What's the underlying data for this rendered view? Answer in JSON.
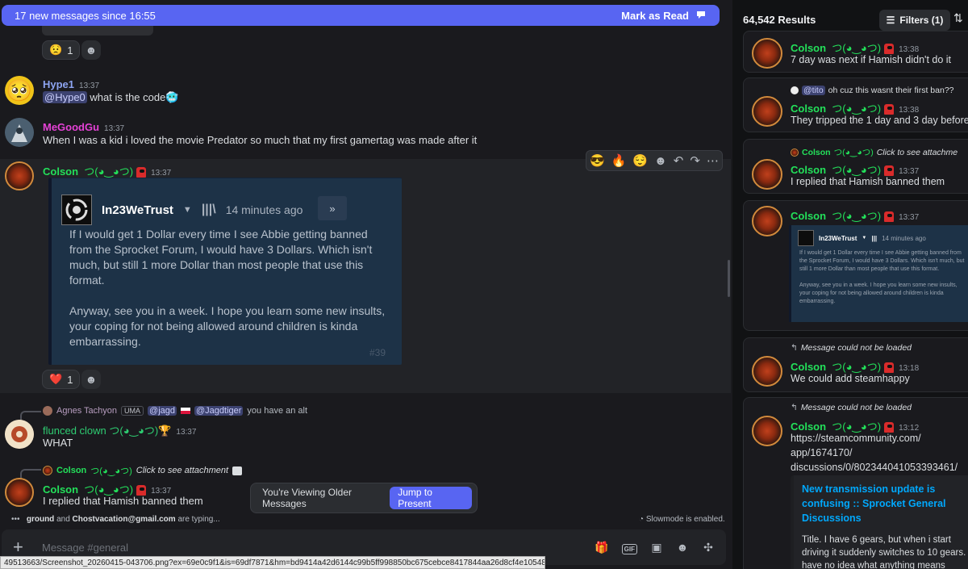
{
  "banner": {
    "text": "17 new messages since 16:55",
    "action": "Mark as Read"
  },
  "colors": {
    "accent": "#5865f2",
    "colson_green": "#23e05a",
    "hype_blue": "#8da4f1",
    "megoodgu_pink": "#e542d6",
    "link": "#00a8fc"
  },
  "top_reactions": {
    "emoji": "😟",
    "count": "1"
  },
  "messages": [
    {
      "author": "Hype1",
      "time": "13:37",
      "mention": "@Hype0",
      "text": " what is the code",
      "emoji": "🥶"
    },
    {
      "author": "MeGoodGu",
      "time": "13:37",
      "text": "When I was a kid i loved the movie Predator so much that my first gamertag was made after it"
    },
    {
      "author": "Colson",
      "suffix": "つ(◕‿◕つ)",
      "time": "13:37"
    },
    {
      "reply_author": "Agnes Tachyon",
      "reply_badge": "UMA",
      "reply_mention1": "@jagd",
      "reply_mention2": "@Jagdtiger",
      "reply_text": "you have an alt",
      "author": "flunced clown",
      "suffix": "つ(◕‿◕つ)",
      "trophy": "🏆",
      "time": "13:37",
      "text": "WHAT"
    },
    {
      "reply_author": "Colson",
      "reply_suffix": "つ(◕‿◕つ)",
      "reply_text": "Click to see attachment",
      "author": "Colson",
      "suffix": "つ(◕‿◕つ)",
      "time": "13:37",
      "text": "I replied that Hamish banned them"
    }
  ],
  "hover_toolbar": {
    "emojis": [
      "😎",
      "🔥",
      "😌"
    ]
  },
  "embed": {
    "username": "In23WeTrust",
    "ago": "14 minutes ago",
    "body": "If I would get 1 Dollar every time I see Abbie getting banned from the Sprocket Forum, I would have 3 Dollars. Which isn't much, but still 1 more Dollar than most people that use this format.\n\nAnyway, see you in a week. I hope you learn some new insults, your coping for not being allowed around children is kinda embarrassing.",
    "post_number": "#39"
  },
  "embed_reactions": {
    "emoji": "❤️",
    "count": "1"
  },
  "older_bar": {
    "text": "You're Viewing Older Messages",
    "jump": "Jump to Present"
  },
  "typing": {
    "user1": "ground",
    "and": "and",
    "user2": "Chostvacation@gmail.com",
    "rest": "are typing..."
  },
  "slowmode": "Slowmode is enabled.",
  "composer": {
    "placeholder": "Message #general"
  },
  "status_url": "49513663/Screenshot_20260415-043706.png?ex=69e0c9f1&is=69df7871&hm=bd9414a42d6144c99b5ff998850bc675cebce8417844aa26d8cf4e10548c5013&",
  "search": {
    "results": "64,542 Results",
    "filters": "Filters (1)",
    "cards": [
      {
        "author": "Colson",
        "suffix": "つ(◕‿◕つ)",
        "time": "13:38",
        "text": "7 day was next if Hamish didn't do it"
      },
      {
        "reply_mention": "@tito",
        "reply_text": "oh cuz this wasnt their first ban??",
        "author": "Colson",
        "suffix": "つ(◕‿◕つ)",
        "time": "13:38",
        "text": "They tripped the 1 day and 3 day before"
      },
      {
        "reply_author": "Colson",
        "reply_suffix": "つ(◕‿◕つ)",
        "reply_text": "Click to see attachme",
        "author": "Colson",
        "suffix": "つ(◕‿◕つ)",
        "time": "13:37",
        "text": "I replied that Hamish banned them"
      },
      {
        "author": "Colson",
        "suffix": "つ(◕‿◕つ)",
        "time": "13:37"
      },
      {
        "reply_text": "Message could not be loaded",
        "author": "Colson",
        "suffix": "つ(◕‿◕つ)",
        "time": "13:18",
        "text": "We could add steamhappy"
      },
      {
        "reply_text": "Message could not be loaded",
        "author": "Colson",
        "suffix": "つ(◕‿◕つ)",
        "time": "13:12",
        "link1": "https://steamcommunity.com/",
        "link2": "app/1674170/",
        "link3": "discussions/0/802344041053393461/",
        "embed_title": "New transmission update is confusing :: Sprocket General Discussions",
        "embed_desc": "Title. I have 6 gears, but when i start driving it suddenly switches to 10 gears. I have no idea what anything means anymore on the"
      }
    ]
  },
  "small_embed": {
    "username": "In23WeTrust",
    "ago": "14 minutes ago",
    "body": "If I would get 1 Dollar every time I see Abbie getting banned from the Sprocket Forum, I would have 3 Dollars. Which isn't much, but still 1 more Dollar than most people that use this format.\n\nAnyway, see you in a week. I hope you learn some new insults, your coping for not being allowed around children is kinda embarrassing."
  }
}
